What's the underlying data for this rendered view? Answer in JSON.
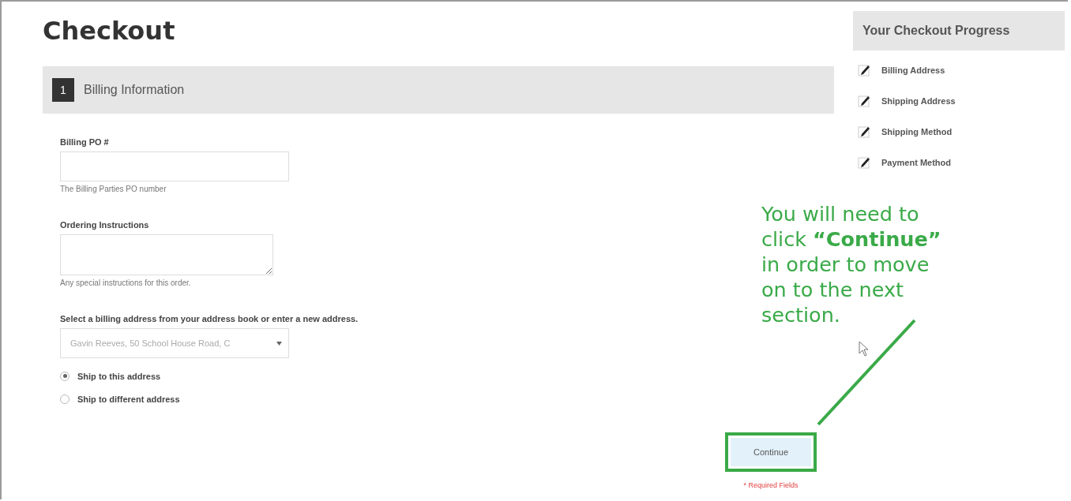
{
  "page_title": "Checkout",
  "step": {
    "number": "1",
    "label": "Billing Information"
  },
  "fields": [
    {
      "kind": "input",
      "label": "Billing PO #",
      "hint": "The Billing Parties PO number"
    },
    {
      "kind": "textarea",
      "label": "Ordering Instructions",
      "hint": "Any special instructions for this order."
    }
  ],
  "address_select": {
    "label": "Select a billing address from your address book or enter a new address.",
    "value": "Gavin Reeves, 50 School House Road, C"
  },
  "radios": [
    {
      "label": "Ship to this address",
      "selected": true
    },
    {
      "label": "Ship to different address",
      "selected": false
    }
  ],
  "continue_button": "Continue",
  "required_note": "* Required Fields",
  "progress": {
    "title": "Your Checkout Progress",
    "items": [
      "Billing Address",
      "Shipping Address",
      "Shipping Method",
      "Payment Method"
    ]
  },
  "annotation": "You will need to click **“Continue”** in order to move on to the next section."
}
